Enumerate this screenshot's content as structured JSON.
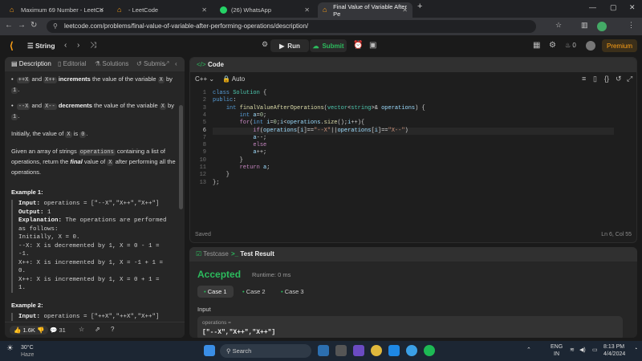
{
  "browser": {
    "tabs": [
      {
        "title": "Maximum 69 Number - LeetCo"
      },
      {
        "title": "- LeetCode"
      },
      {
        "title": "(26) WhatsApp"
      },
      {
        "title": "Final Value of Variable After Pe"
      }
    ],
    "new_tab": "+",
    "url": "leetcode.com/problems/final-value-of-variable-after-performing-operations/description/"
  },
  "header": {
    "problem_list": "String",
    "run_label": "Run",
    "submit_label": "Submit",
    "streak": "0",
    "premium_label": "Premium"
  },
  "left_tabs": {
    "description": "Description",
    "editorial": "Editorial",
    "solutions": "Solutions",
    "submissions": "Submis"
  },
  "description": {
    "b1_code": "++X",
    "b1_and": "and",
    "b1_code2": "X++",
    "b1_bold": "increments",
    "b1_rest": "the value of the variable",
    "b1_var": "X",
    "b1_by": "by",
    "b1_one": "1",
    "b2_code": "--X",
    "b2_and": "and",
    "b2_code2": "X--",
    "b2_bold": "decrements",
    "b2_rest": "the value of the variable",
    "b2_var": "X",
    "b2_by": "by",
    "b2_one": "1",
    "initial": "Initially, the value of",
    "initial_var": "X",
    "initial_is": "is",
    "initial_zero": "0",
    "given_1": "Given an array of strings",
    "given_code": "operations",
    "given_2": "containing a list of operations, return the",
    "given_italic": "final",
    "given_3": "value of",
    "given_var": "X",
    "given_4": "after performing all the operations.",
    "ex1_title": "Example 1:",
    "ex1_input_label": "Input:",
    "ex1_input": "operations = [\"--X\",\"X++\",\"X++\"]",
    "ex1_output_label": "Output:",
    "ex1_output": "1",
    "ex1_expl_label": "Explanation:",
    "ex1_expl": "The operations are performed as follows:",
    "ex1_lines": [
      "Initially, X = 0.",
      "--X: X is decremented by 1, X =  0 - 1 =",
      "-1.",
      "X++: X is incremented by 1, X = -1 + 1 =",
      "0.",
      "X++: X is incremented by 1, X =  0 + 1 =",
      "1."
    ],
    "ex2_title": "Example 2:",
    "ex2_input_label": "Input:",
    "ex2_input": "operations = [\"++X\",\"++X\",\"X++\"]"
  },
  "left_bottom": {
    "likes": "1.6K",
    "comments": "31"
  },
  "code_panel": {
    "title": "Code",
    "language": "C++",
    "mode": "Auto",
    "saved": "Saved",
    "cursor": "Ln 6, Col 55",
    "lines": [
      "1",
      "2",
      "3",
      "4",
      "5",
      "6",
      "7",
      "8",
      "9",
      "10",
      "11",
      "12",
      "13"
    ]
  },
  "test_panel": {
    "testcase_tab": "Testcase",
    "result_tab": "Test Result",
    "status": "Accepted",
    "runtime": "Runtime: 0 ms",
    "cases": [
      "Case 1",
      "Case 2",
      "Case 3"
    ],
    "input_label": "Input",
    "param_name": "operations =",
    "param_value": "[\"--X\",\"X++\",\"X++\"]"
  },
  "taskbar": {
    "temp": "30°C",
    "weather": "Haze",
    "search": "Search",
    "lang": "ENG",
    "region": "IN",
    "time": "8:13 PM",
    "date": "4/4/2024"
  },
  "colors": {
    "accent_orange": "#ffa116",
    "accepted_green": "#2cbb5d",
    "submit_green": "#2cbb5d"
  }
}
